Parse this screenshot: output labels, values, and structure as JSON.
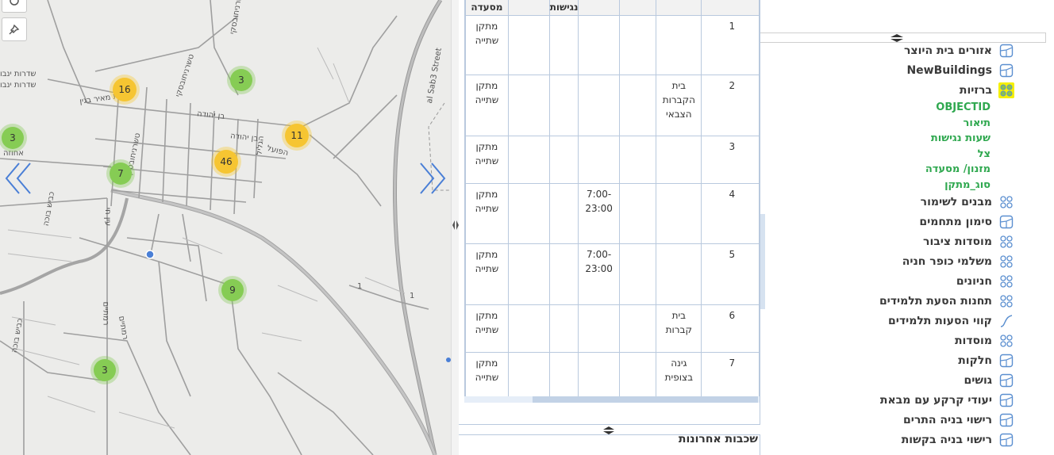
{
  "map": {
    "clusters": [
      {
        "count": "16",
        "color": "yellow"
      },
      {
        "count": "3",
        "color": "green"
      },
      {
        "count": "3",
        "color": "green"
      },
      {
        "count": "11",
        "color": "yellow"
      },
      {
        "count": "46",
        "color": "yellow"
      },
      {
        "count": "7",
        "color": "green"
      },
      {
        "count": "9",
        "color": "green"
      },
      {
        "count": "3",
        "color": "green"
      }
    ],
    "streets": {
      "s1": "שדרות ינבו",
      "s2": "שדרות ינבו",
      "s3": "שדרות מאיר בגין",
      "s4": "טשרניחובסקי",
      "s5": "טשרניחובסקי",
      "s6": "טשרניחובסקי",
      "s7": "בן יהודה",
      "s8": "בן יהודה",
      "s9": "הפועל",
      "s10": "הגליל",
      "s11": "al Sab3 Street",
      "s12": "אחוזה",
      "s13": "כביש בוכה",
      "s14": "עין חי",
      "s15": "רמתיים",
      "s16": "רמתיים",
      "s17": "כביש בוכה",
      "s18": "1",
      "s19": "1"
    }
  },
  "table": {
    "headers": [
      "",
      "",
      "",
      "נגישות",
      "",
      "מסעדה"
    ],
    "rows": [
      {
        "id": "1",
        "desc": "",
        "hours": "",
        "type": "מתקן שתייה"
      },
      {
        "id": "2",
        "desc": "בית הקברות הצבאי",
        "hours": "",
        "type": "מתקן שתייה"
      },
      {
        "id": "3",
        "desc": "",
        "hours": "",
        "type": "מתקן שתייה"
      },
      {
        "id": "4",
        "desc": "",
        "hours": "7:00-23:00",
        "type": "מתקן שתייה"
      },
      {
        "id": "5",
        "desc": "",
        "hours": "7:00-23:00",
        "type": "מתקן שתייה"
      },
      {
        "id": "6",
        "desc": "בית קברות",
        "hours": "",
        "type": "מתקן שתייה"
      },
      {
        "id": "7",
        "desc": "גינה בצופית",
        "hours": "",
        "type": "מתקן שתייה"
      }
    ],
    "recent_title": "שכבות אחרונות"
  },
  "layers": {
    "items": [
      {
        "label": "אזורים בית היוצר",
        "icon": "polygon-layer-icon"
      },
      {
        "label": "NewBuildings",
        "icon": "polygon-layer-icon"
      },
      {
        "label": "ברזיות",
        "icon": "point-layer-icon"
      },
      {
        "label": "מבנים לשימור",
        "icon": "point-layer-icon"
      },
      {
        "label": "סימון מתחמים",
        "icon": "polygon-layer-icon"
      },
      {
        "label": "מוסדות ציבור",
        "icon": "point-layer-icon"
      },
      {
        "label": "משלמי כופר חניה",
        "icon": "point-layer-icon"
      },
      {
        "label": "חניונים",
        "icon": "point-layer-icon"
      },
      {
        "label": "תחנות הסעת תלמידים",
        "icon": "point-layer-icon"
      },
      {
        "label": "קווי הסעות תלמידים",
        "icon": "line-layer-icon"
      },
      {
        "label": "מוסדות",
        "icon": "point-layer-icon"
      },
      {
        "label": "חלקות",
        "icon": "polygon-layer-icon"
      },
      {
        "label": "גושים",
        "icon": "polygon-layer-icon"
      },
      {
        "label": "יעודי קרקע עם מבאת",
        "icon": "polygon-layer-icon"
      },
      {
        "label": "רישוי בניה התרים",
        "icon": "polygon-layer-icon"
      },
      {
        "label": "רישוי בניה בקשות",
        "icon": "polygon-layer-icon"
      }
    ],
    "fields": [
      "OBJECTID",
      "תיאור",
      "שעות נגישות",
      "צל",
      "מזנון/ מסעדה",
      "סוג_מתקן"
    ]
  }
}
